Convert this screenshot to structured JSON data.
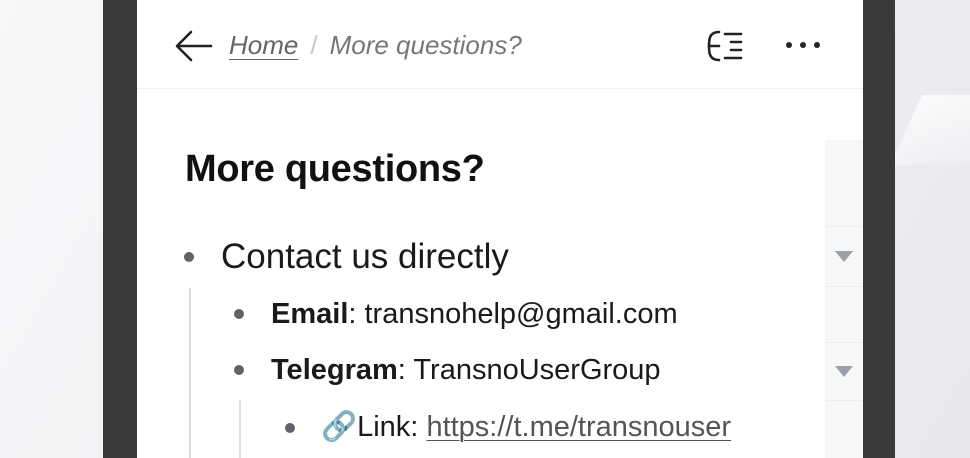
{
  "breadcrumb": {
    "home": "Home",
    "separator": "/",
    "current": "More questions?"
  },
  "page": {
    "title": "More questions?"
  },
  "outline": {
    "contact": {
      "text": "Contact us directly"
    },
    "email": {
      "label": "Email",
      "separator": ":",
      "value": "transnohelp@gmail.com"
    },
    "telegram": {
      "label": "Telegram",
      "separator": ":",
      "value": "TransnoUserGroup"
    },
    "link": {
      "emoji": "🔗",
      "label": "Link:",
      "url": "https://t.me/transnouser"
    }
  },
  "icons": {
    "back": "arrow-left-icon",
    "toc": "table-of-contents-icon",
    "more": "more-horizontal-icon",
    "caret": "caret-down-icon",
    "link": "link-icon"
  },
  "colors": {
    "frame": "#3a3a3a",
    "text": "#1a1a1a",
    "muted": "#777777",
    "bullet": "#5f6368"
  }
}
